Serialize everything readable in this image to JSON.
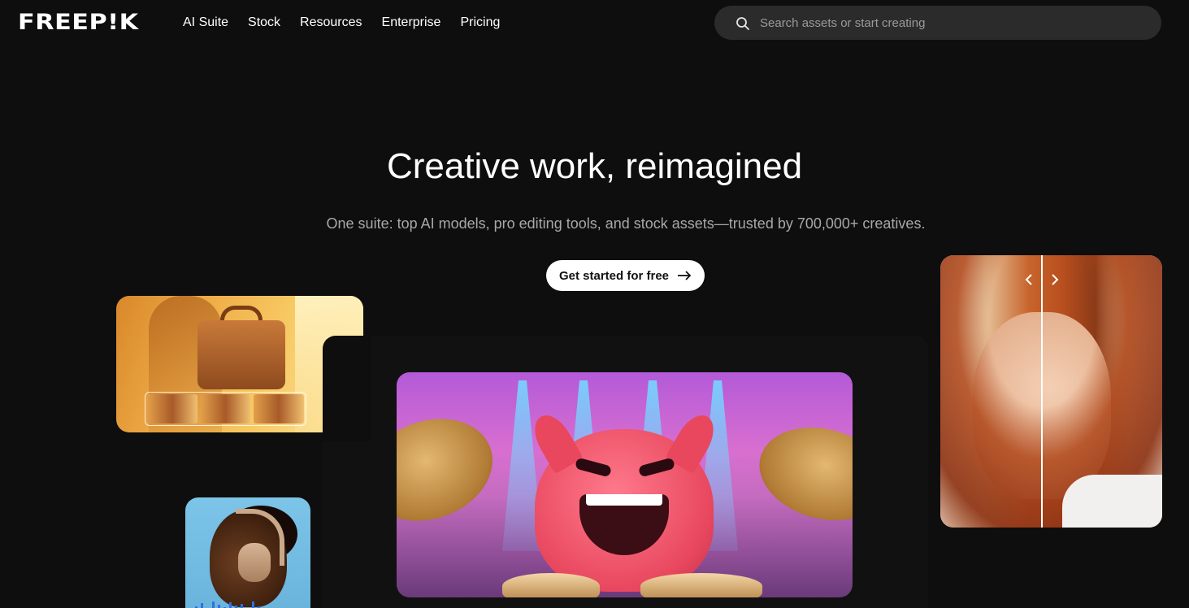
{
  "header": {
    "logo_text": "FREEP!K",
    "nav": [
      "AI Suite",
      "Stock",
      "Resources",
      "Enterprise",
      "Pricing"
    ],
    "search": {
      "placeholder": "Search assets or start creating",
      "icon": "search-icon"
    }
  },
  "hero": {
    "title": "Creative work, reimagined",
    "subtitle": "One suite: top AI models, pro editing tools, and stock assets—trusted by 700,000+ creatives.",
    "cta_label": "Get started for free",
    "cta_icon": "arrow-right-icon"
  },
  "showcase": {
    "cards": [
      {
        "name": "handbag-product-variations"
      },
      {
        "name": "monster-drummer-video"
      },
      {
        "name": "portrait-before-after"
      },
      {
        "name": "headphones-audio"
      }
    ],
    "compare_icons": [
      "chevron-left-icon",
      "chevron-right-icon"
    ]
  },
  "colors": {
    "background": "#0e0e0e",
    "search_bg": "#2b2b2b",
    "cta_bg": "#ffffff",
    "subtitle": "#a8a8a8"
  }
}
